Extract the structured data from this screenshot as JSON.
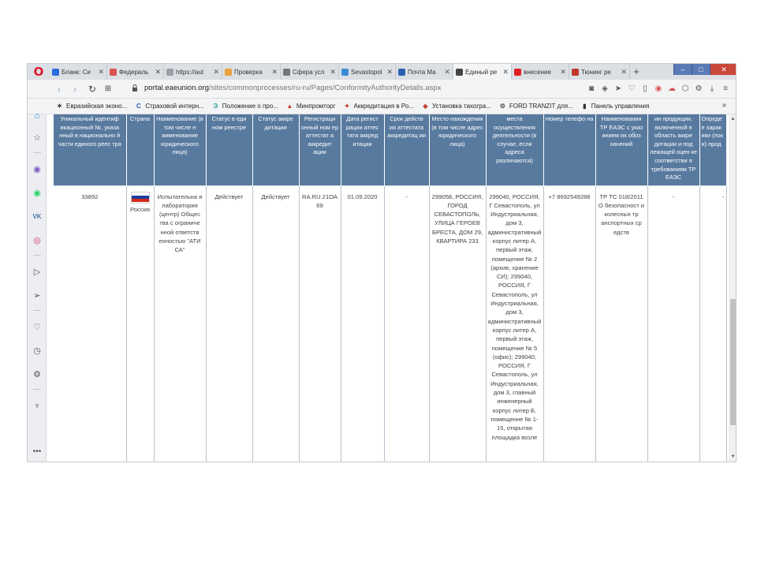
{
  "tabs": [
    {
      "label": "Бланк: Си",
      "favicon_color": "#2d6cdf",
      "active": false
    },
    {
      "label": "Федераль",
      "favicon_color": "#d9534f",
      "active": false
    },
    {
      "label": "https://aut",
      "favicon_color": "#9aa0a6",
      "active": false
    },
    {
      "label": "Проверка",
      "favicon_color": "#e7a23c",
      "active": false
    },
    {
      "label": "Сфера усл",
      "favicon_color": "#777777",
      "active": false
    },
    {
      "label": "Sevastopol",
      "favicon_color": "#3d8bd4",
      "active": false
    },
    {
      "label": "Почта Ма",
      "favicon_color": "#2a62b3",
      "active": false
    },
    {
      "label": "Единый ре",
      "favicon_color": "#444444",
      "active": true
    },
    {
      "label": "внесение",
      "favicon_color": "#e02020",
      "active": false
    },
    {
      "label": "Тюнинг ре",
      "favicon_color": "#c0392b",
      "active": false
    }
  ],
  "window": {
    "minimize": "–",
    "maximize": "□",
    "close": "✕"
  },
  "address": {
    "host": "portal.eaeunion.org",
    "path": "/sites/commonprocesses/ru-ru/Pages/ConformityAuthorityDetails.aspx"
  },
  "bookmarks": [
    {
      "label": "Евразийская эконо...",
      "icon": "✶",
      "color": "#333333"
    },
    {
      "label": "Страховой интерн...",
      "icon": "C",
      "color": "#1f5fbf"
    },
    {
      "label": "Положение о про...",
      "icon": "Э",
      "color": "#26a69a"
    },
    {
      "label": "Минпромторг",
      "icon": "▲",
      "color": "#c0392b"
    },
    {
      "label": "Аккредитация в Ро...",
      "icon": "✦",
      "color": "#c0392b"
    },
    {
      "label": "Установка тахогра...",
      "icon": "◈",
      "color": "#c0392b"
    },
    {
      "label": "FORD TRANZIT для...",
      "icon": "⚙",
      "color": "#555555"
    },
    {
      "label": "Панель управления",
      "icon": "▮",
      "color": "#333333"
    }
  ],
  "table": {
    "headers": [
      "Уникальный идентиф икационный №, указа нный в национально й части единого реес тра",
      "Страна",
      "Наименование (в том числе н аименование юридического лица)",
      "Статус в еди ном реестре",
      "Статус аккре дитации",
      "Регистраци онный ном ер аттестат а аккредит ации",
      "Дата регист рации аттес тата аккред итации",
      "Срок действ ия аттестата аккредитац ии",
      "Место нахождения (в том числе адрес юридического лица)",
      "места осуществления деятельности (в случае, если адреса различаются)",
      "Номер телефо на",
      "Наименования ТР ЕАЭС с указ анием их обоз начений",
      "ии продукции, включенной в область аккре дитации и под лежащей оцен ке соответстви я требованиям ТР ЕАЭС",
      "Опреде е харак ики (пок и) прод"
    ],
    "row": {
      "id": "33892",
      "country": "Россия",
      "name": "Испытательна я лаборатория (центр) Общес тва с ограниче нной ответств енностью \"АТИ СА\"",
      "registry_status": "Действует",
      "accreditation_status": "Действует",
      "reg_number": "RA.RU.21ОА 69",
      "reg_date": "01.09.2020",
      "validity": "-",
      "legal_address": "299058, РОССИЯ, ГОРОД СЕВАСТОПОЛЬ, УЛИЦА ГЕРОЕВ БРЕСТА, ДОМ 29, КВАРТИРА 233",
      "activity_address": "299040, РОССИЯ, Г Севастополь, ул Индустриальная, дом 3, административный корпус литер А, первый этаж, помещение № 2 (архив, хранение СИ); 299040, РОССИЯ, Г Севастополь, ул Индустриальная, дом 3, административный корпус литер А, первый этаж, помещение № 5 (офис); 299040, РОССИЯ, Г Севастополь, ул Индустриальная, дом 3, главный инженерный корпус литер Б, помещение № 1-15, открытая площадка возле",
      "phone": "+7 8692549288",
      "tr_names": "ТР ТС 018/2011 О безопасност и колесных тр анспортных ср едств",
      "product_scope": "-",
      "characteristics": "-"
    }
  },
  "colors": {
    "header_bg": "#587a9f",
    "flag_white": "#ffffff",
    "flag_blue": "#1c3f9e",
    "flag_red": "#d52b1e"
  }
}
